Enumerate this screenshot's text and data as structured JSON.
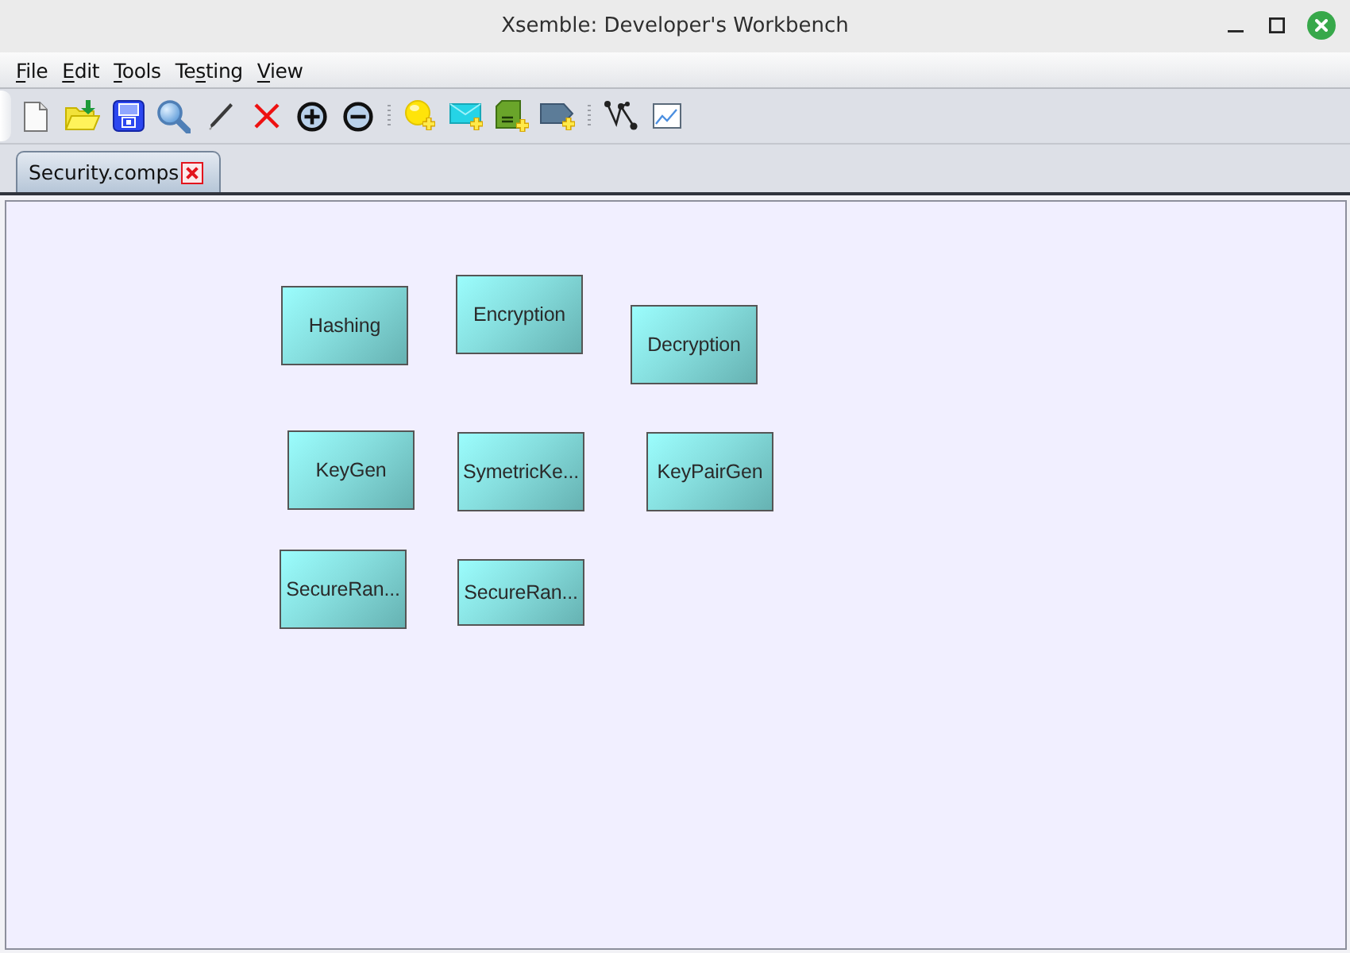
{
  "window": {
    "title": "Xsemble: Developer's Workbench"
  },
  "menu": [
    {
      "mnemonic": "F",
      "text_after": "ile"
    },
    {
      "mnemonic": "E",
      "text_after": "dit"
    },
    {
      "mnemonic": "T",
      "text_after": "ools"
    },
    {
      "text_before": "Te",
      "mnemonic": "s",
      "text_after": "ting"
    },
    {
      "mnemonic": "V",
      "text_after": "iew"
    }
  ],
  "tabs": [
    {
      "label": "Security.comps",
      "selected": true
    }
  ],
  "canvas": {
    "nodes": [
      {
        "label": "Hashing"
      },
      {
        "label": "Encryption"
      },
      {
        "label": "Decryption"
      },
      {
        "label": "KeyGen"
      },
      {
        "label": "SymetricKe..."
      },
      {
        "label": "KeyPairGen"
      },
      {
        "label": "SecureRan..."
      },
      {
        "label": "SecureRan..."
      }
    ]
  }
}
